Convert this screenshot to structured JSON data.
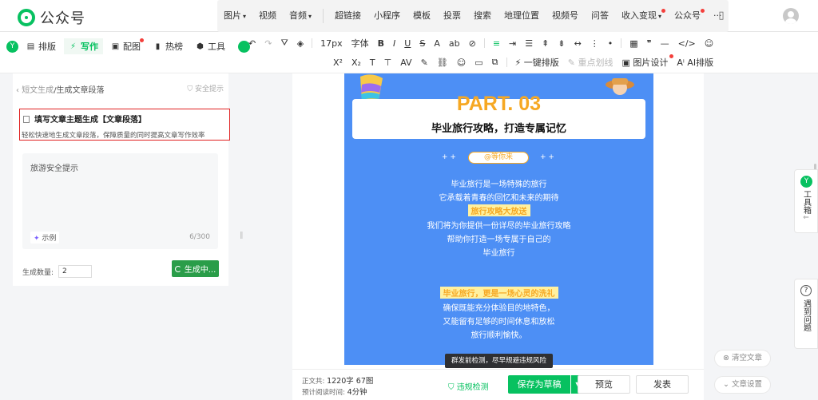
{
  "app": {
    "logo_text": "公众号"
  },
  "top_menu": [
    {
      "label": "图片",
      "caret": true
    },
    {
      "label": "视频",
      "caret": false
    },
    {
      "label": "音频",
      "caret": true
    },
    {
      "label": "超链接",
      "caret": false
    },
    {
      "label": "小程序",
      "caret": false
    },
    {
      "label": "模板",
      "caret": false
    },
    {
      "label": "投票",
      "caret": false
    },
    {
      "label": "搜索",
      "caret": false
    },
    {
      "label": "地理位置",
      "caret": false
    },
    {
      "label": "视频号",
      "caret": false
    },
    {
      "label": "问答",
      "caret": false
    },
    {
      "label": "收入变现",
      "caret": true,
      "dot": true
    },
    {
      "label": "公众号",
      "caret": false,
      "dot": true
    },
    {
      "label": "···",
      "caret": false
    }
  ],
  "left_tabs": [
    {
      "label": "排版",
      "icon": "layout-icon"
    },
    {
      "label": "写作",
      "icon": "ai-write-icon",
      "active": true
    },
    {
      "label": "配图",
      "icon": "image-icon",
      "dot": true
    },
    {
      "label": "热榜",
      "icon": "bookmark-icon"
    },
    {
      "label": "工具",
      "icon": "cube-icon"
    }
  ],
  "toolbar": {
    "font_size": "17px",
    "font_family": "字体",
    "one_click_layout": "一键排版",
    "key_underline": "重点划线",
    "image_design": "图片设计",
    "ai_layout": "AI排版"
  },
  "panel": {
    "breadcrumb_back": "短文生成",
    "breadcrumb_current": "/生成文章段落",
    "safety_hint": "安全提示",
    "card_title": "填写文章主题生成【文章段落】",
    "card_desc": "轻松快速地生成文章段落，保障质量的同时提高文章写作效率",
    "input_value": "旅游安全提示",
    "example_label": "示例",
    "char_count": "6/300",
    "quantity_label": "生成数量:",
    "quantity_value": "2",
    "generate_label": "生成中..."
  },
  "poster": {
    "part": "PART. 03",
    "subtitle": "毕业旅行攻略，打造专属记忆",
    "tag": "@等你来",
    "lines1": [
      "毕业旅行是一场特殊的旅行",
      "它承载着青春的回忆和未来的期待"
    ],
    "highlight1": "旅行攻略大放送",
    "lines2": [
      "我们将为你提供一份详尽的毕业旅行攻略",
      "帮助你打造一场专属于自己的",
      "毕业旅行"
    ],
    "highlight2": "毕业旅行，更是一场心灵的洗礼",
    "lines3": [
      "确保既能充分体验目的地特色，",
      "又能留有足够的时间休息和放松",
      "旅行顺利愉快。"
    ]
  },
  "tooltip": "群发前检测，尽早规避违规风险",
  "footer": {
    "word_label": "正文共:",
    "word_value": "1220字 67图",
    "time_label": "预计阅读时间:",
    "time_value": "4分钟",
    "check_label": "违规检测",
    "save_label": "保存为草稿",
    "preview_label": "预览",
    "publish_label": "发表"
  },
  "side": {
    "toolbox": "工具箱",
    "faq": "遇到问题",
    "clear": "清空文章",
    "settings": "文章设置"
  },
  "colors": {
    "brand": "#07c160",
    "poster_bg": "#4d8ff5",
    "accent": "#f6a823",
    "alert": "#e02020"
  }
}
